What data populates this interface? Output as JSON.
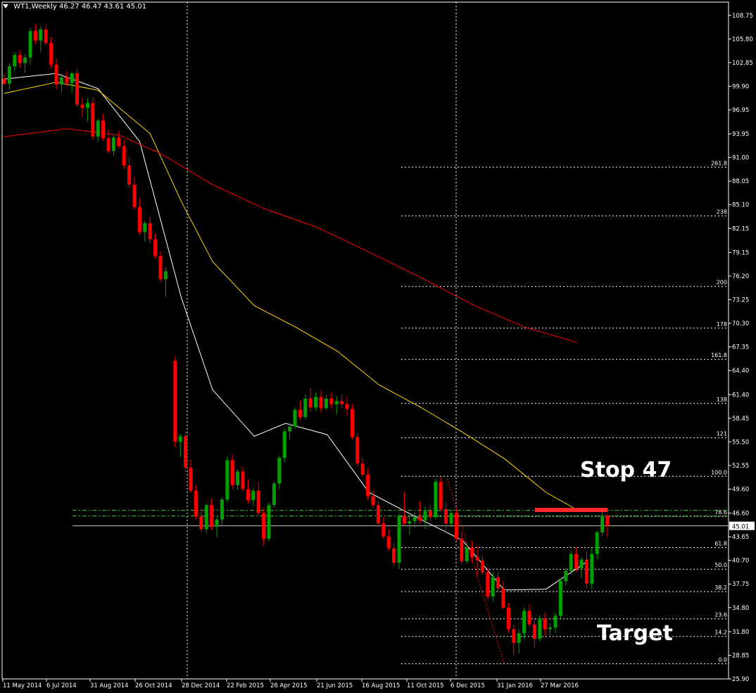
{
  "header": {
    "symbol": "WT1,Weekly",
    "ohlc": "46.27 46.47 43.61 45.01"
  },
  "annotations": {
    "stop": "Stop 47",
    "target": "Target"
  },
  "colors": {
    "background": "#000000",
    "bull": "#00a000",
    "bear": "#ff0000",
    "ma_fast": "#ffffff",
    "ma_mid": "#ffd700",
    "ma_slow": "#ff0000",
    "fib": "#ffffff",
    "stop_line": "#ff2a2a",
    "level_lines": "#32cd32",
    "price_line": "#c0c0c0"
  },
  "chart_data": {
    "type": "candlestick",
    "symbol": "WT1",
    "timeframe": "Weekly",
    "ylim": [
      25.9,
      110.4
    ],
    "y_ticks": [
      "108.75",
      "105.80",
      "102.85",
      "99.90",
      "96.95",
      "93.95",
      "91.00",
      "88.05",
      "85.10",
      "82.15",
      "79.15",
      "76.20",
      "73.25",
      "70.30",
      "67.35",
      "64.40",
      "61.40",
      "58.45",
      "55.50",
      "52.55",
      "49.60",
      "46.60",
      "43.65",
      "40.70",
      "37.75",
      "34.80",
      "31.80",
      "28.85",
      "25.90"
    ],
    "x_ticks": [
      "11 May 2014",
      "6 Jul 2014",
      "31 Aug 2014",
      "26 Oct 2014",
      "28 Dec 2014",
      "22 Feb 2015",
      "26 Apr 2015",
      "21 Jun 2015",
      "16 Aug 2015",
      "11 Oct 2015",
      "6 Dec 2015",
      "31 Jan 2016",
      "27 Mar 2016"
    ],
    "current_price": 45.01,
    "candles": [
      [
        100.8,
        101.4,
        100.0,
        100.2
      ],
      [
        100.2,
        102.8,
        99.5,
        102.4
      ],
      [
        102.4,
        104.1,
        101.8,
        103.8
      ],
      [
        103.8,
        104.4,
        102.2,
        102.8
      ],
      [
        102.8,
        103.9,
        101.6,
        103.5
      ],
      [
        103.5,
        107.2,
        102.6,
        106.8
      ],
      [
        106.8,
        107.6,
        105.2,
        105.6
      ],
      [
        105.6,
        107.4,
        104.2,
        107.0
      ],
      [
        107.0,
        107.6,
        104.9,
        105.3
      ],
      [
        105.3,
        106.0,
        102.1,
        102.6
      ],
      [
        102.6,
        103.4,
        99.5,
        100.1
      ],
      [
        100.1,
        101.5,
        99.1,
        101.0
      ],
      [
        101.0,
        101.8,
        99.9,
        100.3
      ],
      [
        100.3,
        101.7,
        99.1,
        101.5
      ],
      [
        101.5,
        102.0,
        97.3,
        97.6
      ],
      [
        97.6,
        98.5,
        96.1,
        97.2
      ],
      [
        97.2,
        98.4,
        95.5,
        97.8
      ],
      [
        97.8,
        98.5,
        93.2,
        93.6
      ],
      [
        93.6,
        95.9,
        92.9,
        95.6
      ],
      [
        95.6,
        96.4,
        93.1,
        93.4
      ],
      [
        93.4,
        94.5,
        91.5,
        91.8
      ],
      [
        91.8,
        93.9,
        91.2,
        93.5
      ],
      [
        93.5,
        94.3,
        92.1,
        92.4
      ],
      [
        92.4,
        93.2,
        89.6,
        90.0
      ],
      [
        90.0,
        91.1,
        87.2,
        87.6
      ],
      [
        87.6,
        88.6,
        84.5,
        84.8
      ],
      [
        84.8,
        85.9,
        81.4,
        81.7
      ],
      [
        81.7,
        83.1,
        80.5,
        82.8
      ],
      [
        82.8,
        83.6,
        80.3,
        80.8
      ],
      [
        80.8,
        81.5,
        78.4,
        78.7
      ],
      [
        78.7,
        79.3,
        75.4,
        75.8
      ],
      [
        75.8,
        77.3,
        73.6,
        76.8
      ],
      [
        65.6,
        66.1,
        54.8,
        55.5
      ],
      [
        55.5,
        56.5,
        53.6,
        56.2
      ],
      [
        56.2,
        56.9,
        51.8,
        52.3
      ],
      [
        52.3,
        53.3,
        49.1,
        49.4
      ],
      [
        49.4,
        50.1,
        45.8,
        46.2
      ],
      [
        46.2,
        47.2,
        44.2,
        44.6
      ],
      [
        44.6,
        47.8,
        44.1,
        47.6
      ],
      [
        47.6,
        48.4,
        44.5,
        44.9
      ],
      [
        44.9,
        46.2,
        43.6,
        45.8
      ],
      [
        45.8,
        48.6,
        45.1,
        48.3
      ],
      [
        48.3,
        53.6,
        47.9,
        53.2
      ],
      [
        53.2,
        53.9,
        49.6,
        50.1
      ],
      [
        50.1,
        52.1,
        49.5,
        51.8
      ],
      [
        51.8,
        52.4,
        49.3,
        49.6
      ],
      [
        49.6,
        50.8,
        47.8,
        48.2
      ],
      [
        48.2,
        49.8,
        47.5,
        49.4
      ],
      [
        49.4,
        50.5,
        46.3,
        46.6
      ],
      [
        46.6,
        47.2,
        42.6,
        43.4
      ],
      [
        43.4,
        47.9,
        43.1,
        47.6
      ],
      [
        47.6,
        50.5,
        47.3,
        50.3
      ],
      [
        50.3,
        53.8,
        49.6,
        53.5
      ],
      [
        53.5,
        57.2,
        52.9,
        56.8
      ],
      [
        56.8,
        57.9,
        55.8,
        57.4
      ],
      [
        57.4,
        59.8,
        57.1,
        59.5
      ],
      [
        59.5,
        60.6,
        58.2,
        58.6
      ],
      [
        58.6,
        61.4,
        58.3,
        60.9
      ],
      [
        60.9,
        62.2,
        59.3,
        59.8
      ],
      [
        59.8,
        61.6,
        59.4,
        61.1
      ],
      [
        61.1,
        61.9,
        59.2,
        59.7
      ],
      [
        59.7,
        61.4,
        59.5,
        60.9
      ],
      [
        60.9,
        61.7,
        59.7,
        60.2
      ],
      [
        60.2,
        61.2,
        58.9,
        60.6
      ],
      [
        60.6,
        61.4,
        59.7,
        60.2
      ],
      [
        60.2,
        61.1,
        58.8,
        59.6
      ],
      [
        59.6,
        60.2,
        55.8,
        56.1
      ],
      [
        56.1,
        56.6,
        52.4,
        52.8
      ],
      [
        52.8,
        53.5,
        51.1,
        51.4
      ],
      [
        51.4,
        52.1,
        48.3,
        48.7
      ],
      [
        48.7,
        49.4,
        47.3,
        47.6
      ],
      [
        47.6,
        48.2,
        44.9,
        45.3
      ],
      [
        45.3,
        46.1,
        43.4,
        43.7
      ],
      [
        43.7,
        44.6,
        41.9,
        42.2
      ],
      [
        42.2,
        42.9,
        40.0,
        40.4
      ],
      [
        40.4,
        46.6,
        39.6,
        46.2
      ],
      [
        46.2,
        49.2,
        45.1,
        45.3
      ],
      [
        45.3,
        46.1,
        43.9,
        45.6
      ],
      [
        45.6,
        46.7,
        44.8,
        46.1
      ],
      [
        46.1,
        48.1,
        45.3,
        45.7
      ],
      [
        45.7,
        47.4,
        44.6,
        46.9
      ],
      [
        46.9,
        47.6,
        45.6,
        46.1
      ],
      [
        46.1,
        50.9,
        45.8,
        50.5
      ],
      [
        50.5,
        51.1,
        46.8,
        47.1
      ],
      [
        47.1,
        47.9,
        44.2,
        45.3
      ],
      [
        45.3,
        47.0,
        44.8,
        46.6
      ],
      [
        46.6,
        47.1,
        43.1,
        43.4
      ],
      [
        43.4,
        44.3,
        40.2,
        40.6
      ],
      [
        40.6,
        42.6,
        40.3,
        42.3
      ],
      [
        42.3,
        43.1,
        40.4,
        41.1
      ],
      [
        41.1,
        42.6,
        38.6,
        40.7
      ],
      [
        40.7,
        41.3,
        38.9,
        39.2
      ],
      [
        39.2,
        39.8,
        35.9,
        36.2
      ],
      [
        36.2,
        39.2,
        35.6,
        38.6
      ],
      [
        38.6,
        39.3,
        36.8,
        37.2
      ],
      [
        37.2,
        38.1,
        34.6,
        34.8
      ],
      [
        34.8,
        35.4,
        31.7,
        32.1
      ],
      [
        32.1,
        32.7,
        28.9,
        30.4
      ],
      [
        30.4,
        32.1,
        29.1,
        31.6
      ],
      [
        31.6,
        34.8,
        30.9,
        34.4
      ],
      [
        34.4,
        35.2,
        32.4,
        32.7
      ],
      [
        32.7,
        33.5,
        29.8,
        30.9
      ],
      [
        30.9,
        33.8,
        30.6,
        33.4
      ],
      [
        33.4,
        34.2,
        31.3,
        32.1
      ],
      [
        32.1,
        32.9,
        31.2,
        32.3
      ],
      [
        32.3,
        34.2,
        31.6,
        33.8
      ],
      [
        33.8,
        38.4,
        33.4,
        38.1
      ],
      [
        38.1,
        39.8,
        37.6,
        39.4
      ],
      [
        39.4,
        41.9,
        38.9,
        41.5
      ],
      [
        41.5,
        42.3,
        39.3,
        39.7
      ],
      [
        39.7,
        41.1,
        38.5,
        40.8
      ],
      [
        40.8,
        41.8,
        37.2,
        37.8
      ],
      [
        37.8,
        42.3,
        37.1,
        41.5
      ],
      [
        41.5,
        44.4,
        40.8,
        44.2
      ],
      [
        44.2,
        46.8,
        43.7,
        46.3
      ],
      [
        46.3,
        46.5,
        43.6,
        45.0
      ]
    ],
    "moving_averages": [
      {
        "color": "#ffffff",
        "points": [
          [
            0,
            100.8
          ],
          [
            10,
            101.5
          ],
          [
            18,
            99.6
          ],
          [
            26,
            93.0
          ],
          [
            34,
            73.5
          ],
          [
            40,
            62.0
          ],
          [
            48,
            56.2
          ],
          [
            54,
            57.8
          ],
          [
            62,
            56.4
          ],
          [
            70,
            49.2
          ],
          [
            80,
            45.8
          ],
          [
            88,
            43.2
          ],
          [
            96,
            37.0
          ],
          [
            104,
            37.1
          ],
          [
            112,
            40.6
          ]
        ]
      },
      {
        "color": "#ffd700",
        "points": [
          [
            0,
            99.0
          ],
          [
            10,
            100.4
          ],
          [
            18,
            99.4
          ],
          [
            28,
            94.0
          ],
          [
            34,
            85.5
          ],
          [
            40,
            78.0
          ],
          [
            48,
            72.5
          ],
          [
            56,
            69.8
          ],
          [
            64,
            66.8
          ],
          [
            72,
            62.6
          ],
          [
            80,
            59.8
          ],
          [
            88,
            56.7
          ],
          [
            96,
            53.4
          ],
          [
            104,
            49.2
          ],
          [
            110,
            47.0
          ]
        ]
      },
      {
        "color": "#ff0000",
        "points": [
          [
            0,
            93.6
          ],
          [
            12,
            94.6
          ],
          [
            22,
            93.8
          ],
          [
            30,
            91.5
          ],
          [
            40,
            87.6
          ],
          [
            50,
            84.6
          ],
          [
            60,
            82.3
          ],
          [
            70,
            79.2
          ],
          [
            80,
            76.0
          ],
          [
            90,
            72.6
          ],
          [
            100,
            69.8
          ],
          [
            110,
            67.9
          ]
        ]
      }
    ],
    "fibonacci": {
      "levels": [
        {
          "label": "261.8",
          "price": 89.8
        },
        {
          "label": "238",
          "price": 83.7
        },
        {
          "label": "200",
          "price": 74.9
        },
        {
          "label": "178",
          "price": 69.7
        },
        {
          "label": "161.8",
          "price": 65.8
        },
        {
          "label": "138",
          "price": 60.3
        },
        {
          "label": "121",
          "price": 56.0
        },
        {
          "label": "100.0",
          "price": 51.2
        },
        {
          "label": "78.6",
          "price": 46.2
        },
        {
          "label": "61.8",
          "price": 42.3
        },
        {
          "label": "50.0",
          "price": 39.6
        },
        {
          "label": "38.2",
          "price": 36.8
        },
        {
          "label": "23.6",
          "price": 33.4
        },
        {
          "label": "14.2",
          "price": 31.2
        },
        {
          "label": "0.0",
          "price": 27.8
        }
      ]
    },
    "stop_level": 47.0,
    "level_lines": [
      46.95,
      46.25
    ],
    "vertical_markers": [
      "28 Dec 2014",
      "6 Dec 2015"
    ]
  }
}
